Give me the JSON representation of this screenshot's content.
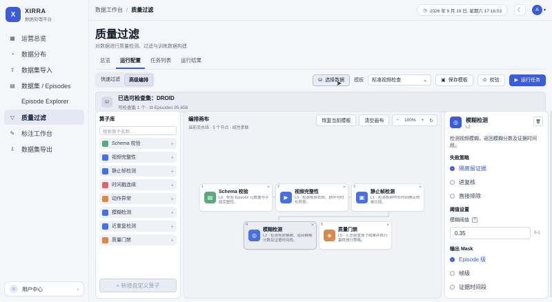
{
  "brand": {
    "name": "XIRRA",
    "subtitle": "数据处理平台",
    "logo_letter": "X"
  },
  "nav": [
    {
      "icon": "▦",
      "label": "运营总览"
    },
    {
      "icon": "◔",
      "label": "数据分布"
    },
    {
      "icon": "⇧",
      "label": "数据集导入"
    },
    {
      "icon": "▤",
      "label": "数据集 / Episodes"
    },
    {
      "icon": "",
      "label": "Episode Explorer"
    },
    {
      "icon": "▽",
      "label": "质量过滤",
      "active": true
    },
    {
      "icon": "✎",
      "label": "标注工作台"
    },
    {
      "icon": "⇩",
      "label": "数据集导出"
    }
  ],
  "user_center": {
    "label": "用户中心"
  },
  "breadcrumb": {
    "parent": "数据工作台",
    "separator": "/",
    "current": "质量过滤"
  },
  "clock": {
    "text": "2026 年 9 月 19 日, 星期六 17:16:03"
  },
  "user_avatar": "A",
  "page": {
    "title": "质量过滤",
    "subtitle": "对数据进行质量检测、过滤与训练数据构建"
  },
  "tabs": [
    "总览",
    "运行配置",
    "任务列表",
    "运行结果"
  ],
  "active_tab": 1,
  "mode": {
    "quick": "快速过滤",
    "advanced": "高级编排"
  },
  "toolbar": {
    "choose_data": "选择数据",
    "template_label": "模板",
    "template_value": "标准视频检查",
    "save_template": "保存模板",
    "validate": "校验",
    "run": "运行任务"
  },
  "dataset": {
    "title": "已选可检查集：DROID",
    "meta": "可检查集 1 个 · ⊟ Episodes 95,658"
  },
  "library": {
    "title": "算子库",
    "search_placeholder": "搜索算子名称...",
    "items": [
      {
        "label": "Schema 校验",
        "color": "#5ea77c"
      },
      {
        "label": "视频完整性",
        "color": "#4a6fe0"
      },
      {
        "label": "静止帧检测",
        "color": "#4a6fe0"
      },
      {
        "label": "时间戳连续",
        "color": "#d46a6a"
      },
      {
        "label": "动作异常",
        "color": "#d98a4a"
      },
      {
        "label": "模糊检测",
        "color": "#4a6fe0"
      },
      {
        "label": "近重复检测",
        "color": "#4a6fe0"
      },
      {
        "label": "质量门禁",
        "color": "#d98a4a"
      }
    ],
    "add_button": "+ 新增自定义算子"
  },
  "canvas": {
    "title": "编排画布",
    "subtitle": "当前流水线 · 5 个节点 · 线性串联",
    "restore": "恢复当前模板",
    "clear": "清空画布",
    "zoom_minus": "−",
    "zoom_value": "100%",
    "zoom_plus": "+",
    "nodes": [
      {
        "num": "1",
        "title": "Schema 校验",
        "desc": "L0 · 校验 Episode 元数据与字段完整性。",
        "color": "#5ea77c",
        "icon": "▤"
      },
      {
        "num": "2",
        "title": "视频完整性",
        "desc": "L0 · 检测视频丢帧、损坏与时长异常。",
        "color": "#4a6fe0",
        "icon": "▶"
      },
      {
        "num": "3",
        "title": "静止帧检测",
        "desc": "L1 · 检测视频中长时间静止的帧片段。",
        "color": "#4a6fe0",
        "icon": "▣"
      },
      {
        "num": "4",
        "title": "模糊检测",
        "desc": "L2 · 检测视频模糊、返回模糊分数及证据时间段。",
        "color": "#4a6fe0",
        "icon": "◎"
      },
      {
        "num": "5",
        "title": "质量门禁",
        "desc": "L5 · 汇总前置算子结果并执行最终放行策略。",
        "color": "#d98a4a",
        "icon": "◈"
      }
    ]
  },
  "detail": {
    "title": "模糊检测",
    "level": "L2",
    "desc": "检测视频模糊，返回模糊分数及证据时间段。",
    "failure_section": "失败策略",
    "failure_options": [
      "隔离留证据",
      "进复核",
      "直接排除"
    ],
    "failure_selected": 0,
    "threshold_section": "阈值设置",
    "threshold_label": "模糊阈值",
    "threshold_value": "0.35",
    "threshold_range": "0-1",
    "mask_section": "输出 Mask",
    "mask_options": [
      "Episode 级",
      "帧级",
      "证据时间段"
    ],
    "mask_selected": 0
  }
}
